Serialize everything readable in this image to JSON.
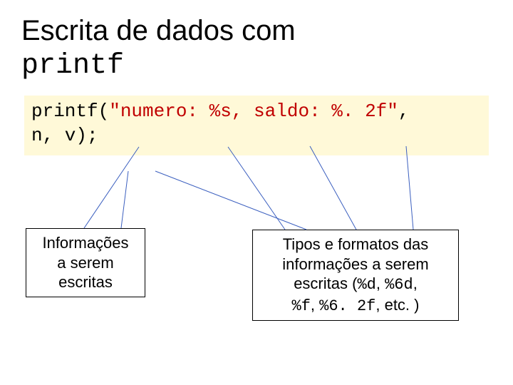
{
  "title": {
    "line1": "Escrita de dados com",
    "line2_mono": "printf"
  },
  "code": {
    "pre": "printf(",
    "str": "\"numero: %s, saldo: %. 2f\"",
    "post1": ",",
    "line2": "       n, v);"
  },
  "boxLeft": {
    "l1": "Informações",
    "l2": "a serem",
    "l3": "escritas"
  },
  "boxRight": {
    "l1": "Tipos e formatos das",
    "l2": "informações a serem",
    "l3_a": "escritas (",
    "l3_m1": "%d",
    "l3_b": ", ",
    "l3_m2": "%6d",
    "l3_c": ",",
    "l4_m1": "%f",
    "l4_a": ", ",
    "l4_m2": "%6. 2f",
    "l4_b": ", etc. )"
  }
}
